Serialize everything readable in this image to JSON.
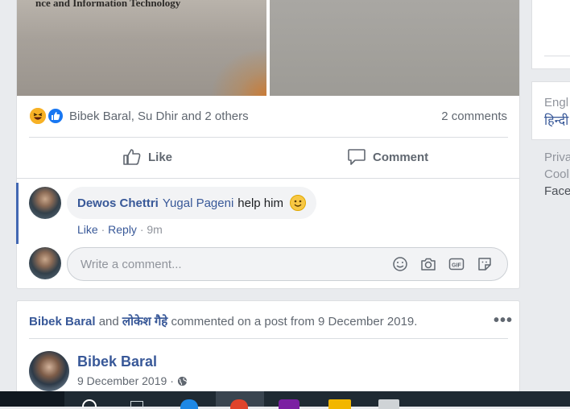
{
  "post": {
    "photo_caption": "nce and Information Technology",
    "reactor_names": "Bibek Baral, Su Dhir and 2 others",
    "comment_count": "2 comments",
    "like_label": "Like",
    "comment_label": "Comment"
  },
  "comment": {
    "author": "Dewos Chettri",
    "mention": "Yugal Pageni",
    "text": "help him",
    "like": "Like",
    "sep": "·",
    "reply": "Reply",
    "time": "9m"
  },
  "write_comment": {
    "placeholder": "Write a comment..."
  },
  "second_post": {
    "actor1": "Bibek Baral",
    "and": "and",
    "actor2": "लोकेश गैहे",
    "activity_text": "commented on a post from 9 December 2019.",
    "author": "Bibek Baral",
    "date": "9 December 2019",
    "sep": "·"
  },
  "sidebar": {
    "lang_english": "Engl",
    "lang_hindi": "हिन्दी",
    "footer_privacy": "Priva",
    "footer_cookies": "Cool",
    "footer_facebook": "Face"
  },
  "colors": {
    "link": "#385898",
    "like_blue": "#1877f2",
    "background": "#e9ebee"
  }
}
